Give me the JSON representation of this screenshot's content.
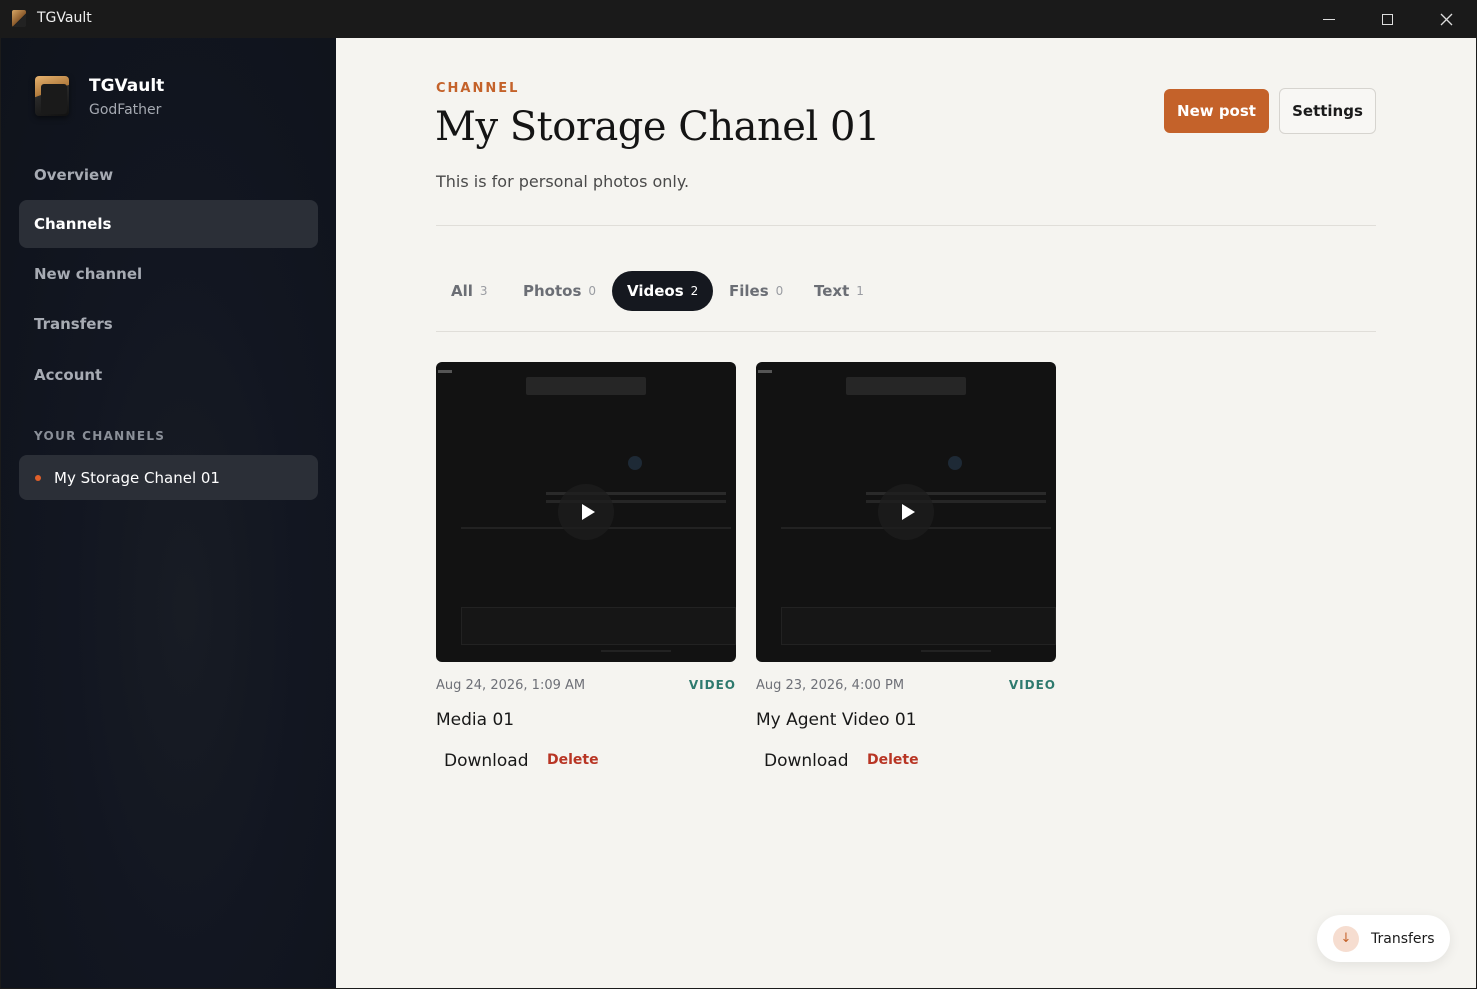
{
  "window": {
    "title": "TGVault"
  },
  "brand": {
    "name": "TGVault",
    "user": "GodFather"
  },
  "nav": {
    "overview": "Overview",
    "channels": "Channels",
    "new_channel": "New channel",
    "transfers": "Transfers",
    "account": "Account"
  },
  "sidebar": {
    "section_label": "YOUR CHANNELS",
    "channels": [
      {
        "name": "My Storage Chanel 01"
      }
    ]
  },
  "header": {
    "eyebrow": "CHANNEL",
    "title": "My Storage Chanel 01",
    "description": "This is for personal photos only.",
    "new_post": "New post",
    "settings": "Settings"
  },
  "tabs": [
    {
      "label": "All",
      "count": "3"
    },
    {
      "label": "Photos",
      "count": "0"
    },
    {
      "label": "Videos",
      "count": "2",
      "active": true
    },
    {
      "label": "Files",
      "count": "0"
    },
    {
      "label": "Text",
      "count": "1"
    }
  ],
  "media": [
    {
      "date": "Aug 24, 2026, 1:09 AM",
      "type": "VIDEO",
      "title": "Media 01",
      "download": "Download",
      "delete": "Delete"
    },
    {
      "date": "Aug 23, 2026, 4:00 PM",
      "type": "VIDEO",
      "title": "My Agent Video 01",
      "download": "Download",
      "delete": "Delete"
    }
  ],
  "float_button": {
    "label": "Transfers",
    "icon": "↓"
  },
  "colors": {
    "accent": "#c4622a",
    "sidebar": "#121621",
    "video_tag": "#2e7a6e",
    "delete": "#b83524"
  }
}
